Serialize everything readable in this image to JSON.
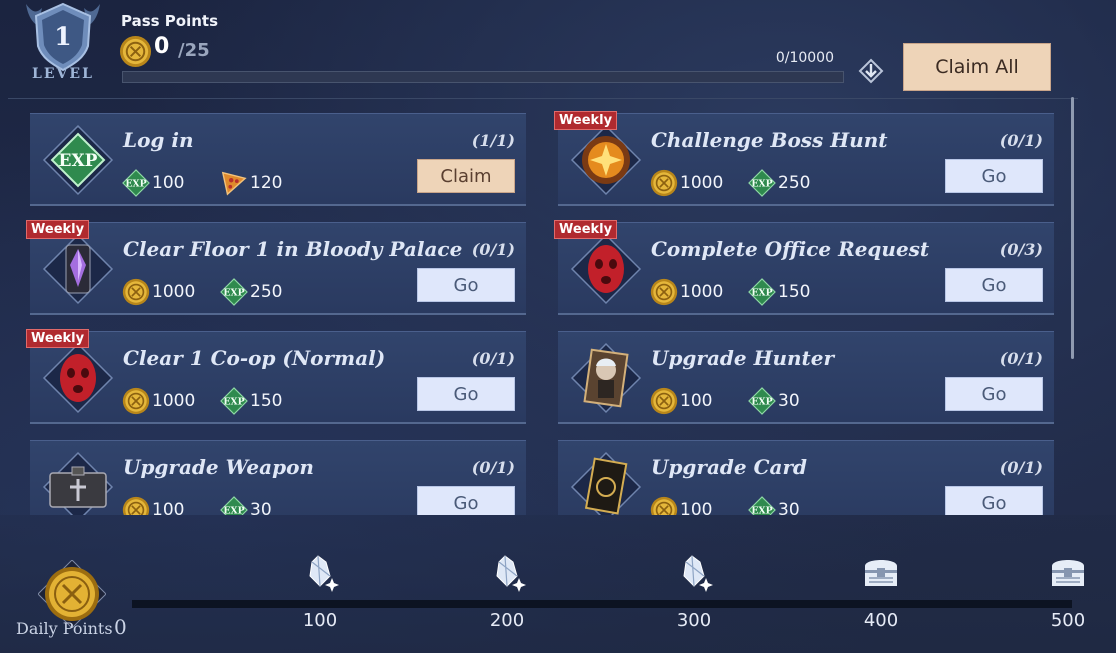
{
  "header": {
    "level_value": "1",
    "level_label": "LEVEL",
    "pass_points_title": "Pass Points",
    "pass_points_current": "0",
    "pass_points_max": "/25",
    "exp_text": "0/10000",
    "exp_progress": 0,
    "claim_all_label": "Claim All"
  },
  "tasks": [
    {
      "title": "Log in",
      "progress": "(1/1)",
      "weekly": false,
      "rewards": [
        {
          "icon": "exp-icon",
          "amount": "100"
        },
        {
          "icon": "pizza-icon",
          "amount": "120"
        }
      ],
      "button": "Claim",
      "button_type": "claim"
    },
    {
      "title": "Challenge Boss Hunt",
      "progress": "(0/1)",
      "weekly": true,
      "weekly_label": "Weekly",
      "rewards": [
        {
          "icon": "coin-icon",
          "amount": "1000"
        },
        {
          "icon": "exp-icon",
          "amount": "250"
        }
      ],
      "button": "Go",
      "button_type": "go"
    },
    {
      "title": "Clear Floor 1 in Bloody Palace",
      "progress": "(0/1)",
      "weekly": true,
      "weekly_label": "Weekly",
      "rewards": [
        {
          "icon": "coin-icon",
          "amount": "1000"
        },
        {
          "icon": "exp-icon",
          "amount": "250"
        }
      ],
      "button": "Go",
      "button_type": "go"
    },
    {
      "title": "Complete Office Request",
      "progress": "(0/3)",
      "weekly": true,
      "weekly_label": "Weekly",
      "rewards": [
        {
          "icon": "coin-icon",
          "amount": "1000"
        },
        {
          "icon": "exp-icon",
          "amount": "150"
        }
      ],
      "button": "Go",
      "button_type": "go"
    },
    {
      "title": "Clear 1 Co-op (Normal)",
      "progress": "(0/1)",
      "weekly": true,
      "weekly_label": "Weekly",
      "rewards": [
        {
          "icon": "coin-icon",
          "amount": "1000"
        },
        {
          "icon": "exp-icon",
          "amount": "150"
        }
      ],
      "button": "Go",
      "button_type": "go"
    },
    {
      "title": "Upgrade Hunter",
      "progress": "(0/1)",
      "weekly": false,
      "rewards": [
        {
          "icon": "coin-icon",
          "amount": "100"
        },
        {
          "icon": "exp-icon",
          "amount": "30"
        }
      ],
      "button": "Go",
      "button_type": "go"
    },
    {
      "title": "Upgrade Weapon",
      "progress": "(0/1)",
      "weekly": false,
      "rewards": [
        {
          "icon": "coin-icon",
          "amount": "100"
        },
        {
          "icon": "exp-icon",
          "amount": "30"
        }
      ],
      "button": "Go",
      "button_type": "go"
    },
    {
      "title": "Upgrade Card",
      "progress": "(0/1)",
      "weekly": false,
      "rewards": [
        {
          "icon": "coin-icon",
          "amount": "100"
        },
        {
          "icon": "exp-icon",
          "amount": "30"
        }
      ],
      "button": "Go",
      "button_type": "go"
    }
  ],
  "footer": {
    "daily_points_label": "Daily Points",
    "daily_points_value": "0",
    "milestones": [
      {
        "value": "100",
        "icon": "crystal-icon"
      },
      {
        "value": "200",
        "icon": "crystal-icon"
      },
      {
        "value": "300",
        "icon": "crystal-icon"
      },
      {
        "value": "400",
        "icon": "chest-icon"
      },
      {
        "value": "500",
        "icon": "chest-icon"
      }
    ]
  },
  "colors": {
    "accent_claim": "#eed4b8",
    "go_button": "#dfe7fb",
    "weekly_badge": "#b02a2f",
    "coin_gold": "#d9a521",
    "exp_green": "#2f8a4e"
  }
}
